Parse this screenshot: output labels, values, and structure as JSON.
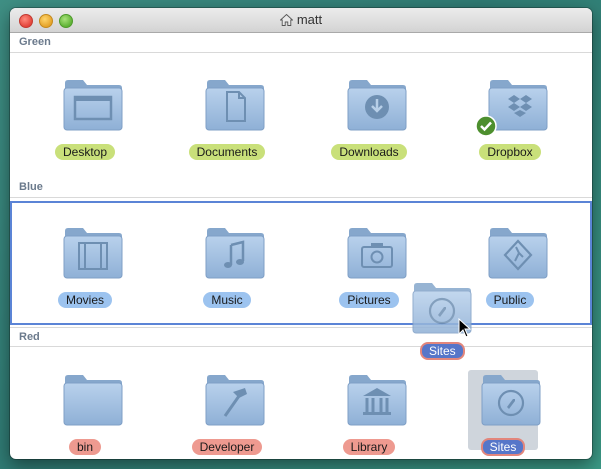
{
  "window": {
    "title": "matt"
  },
  "groups": [
    {
      "name": "Green",
      "items": [
        {
          "label": "Desktop",
          "icon": "desktop-folder-icon"
        },
        {
          "label": "Documents",
          "icon": "documents-folder-icon"
        },
        {
          "label": "Downloads",
          "icon": "downloads-folder-icon"
        },
        {
          "label": "Dropbox",
          "icon": "dropbox-folder-icon"
        }
      ]
    },
    {
      "name": "Blue",
      "items": [
        {
          "label": "Movies",
          "icon": "movies-folder-icon"
        },
        {
          "label": "Music",
          "icon": "music-folder-icon"
        },
        {
          "label": "Pictures",
          "icon": "pictures-folder-icon"
        },
        {
          "label": "Public",
          "icon": "public-folder-icon"
        }
      ]
    },
    {
      "name": "Red",
      "items": [
        {
          "label": "bin",
          "icon": "generic-folder-icon"
        },
        {
          "label": "Developer",
          "icon": "developer-folder-icon"
        },
        {
          "label": "Library",
          "icon": "library-folder-icon"
        },
        {
          "label": "Sites",
          "icon": "sites-folder-icon"
        }
      ]
    }
  ],
  "drag_item": {
    "label": "Sites",
    "icon": "sites-folder-icon"
  },
  "colors": {
    "green_tag": "#c9e07a",
    "blue_tag": "#9cc3ef",
    "red_tag": "#ee9a90",
    "selection": "#5b84d6"
  }
}
